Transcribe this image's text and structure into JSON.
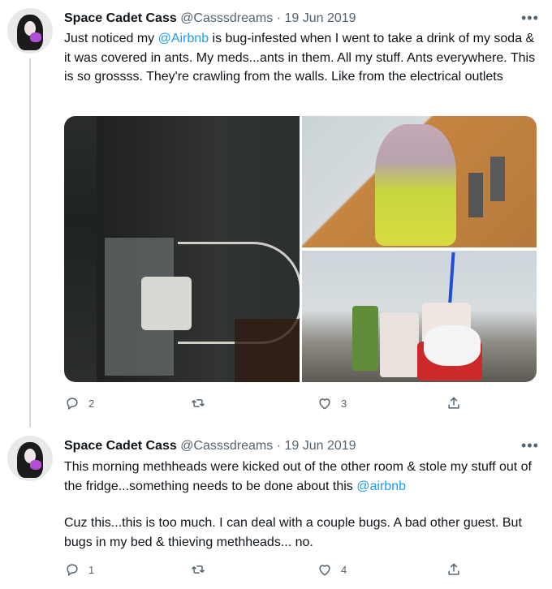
{
  "tweets": [
    {
      "name": "Space Cadet Cass",
      "handle": "@Casssdreams",
      "separator": "·",
      "date": "19 Jun 2019",
      "more": "•••",
      "text_parts": [
        "Just noticed my ",
        "@Airbnb",
        " is bug-infested when I went to take a drink of my soda & it was covered in ants. My meds...ants in them. All my stuff. Ants everywhere. This is so grossss. They're crawling from the walls. Like from the electrical outlets"
      ],
      "reply_count": "2",
      "like_count": "3"
    },
    {
      "name": "Space Cadet Cass",
      "handle": "@Casssdreams",
      "separator": "·",
      "date": "19 Jun 2019",
      "more": "•••",
      "text_parts": [
        "This morning methheads were kicked out of the other room & stole my stuff out of the fridge...something needs to be done about this ",
        "@airbnb",
        "Cuz this...this is too much. I can deal with a couple bugs. A bad other guest. But bugs in my bed & thieving methheads... no."
      ],
      "reply_count": "1",
      "like_count": "4"
    }
  ],
  "icons": {
    "reply": "reply-icon",
    "retweet": "retweet-icon",
    "like": "like-icon",
    "share": "share-icon"
  },
  "colors": {
    "link": "#1d9bf0",
    "muted": "#536471",
    "text": "#0f1419"
  }
}
